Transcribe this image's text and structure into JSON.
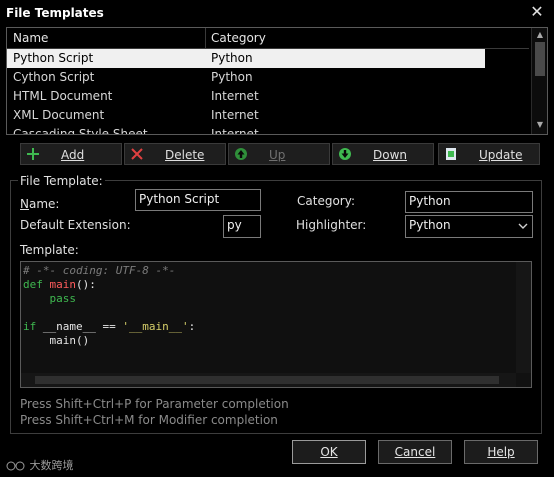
{
  "window": {
    "title": "File Templates",
    "close_glyph": "✕"
  },
  "table": {
    "columns": [
      "Name",
      "Category"
    ],
    "rows": [
      {
        "name": "Python Script",
        "category": "Python",
        "selected": true
      },
      {
        "name": "Cython Script",
        "category": "Python"
      },
      {
        "name": "HTML Document",
        "category": "Internet"
      },
      {
        "name": "XML Document",
        "category": "Internet"
      },
      {
        "name": "Cascading Style Sheet",
        "category": "Internet"
      }
    ]
  },
  "toolbar": {
    "add": "Add",
    "delete": "Delete",
    "up": "Up",
    "down": "Down",
    "update": "Update"
  },
  "file_template": {
    "group_label": "File Template:",
    "name_label": "Name:",
    "name_value": "Python Script",
    "ext_label": "Default Extension:",
    "ext_value": "py",
    "category_label": "Category:",
    "category_value": "Python",
    "highlighter_label": "Highlighter:",
    "highlighter_value": "Python",
    "template_label": "Template:"
  },
  "editor": {
    "lines": [
      "# -*- coding: UTF-8 -*-",
      "def main():",
      "    pass",
      "",
      "if __name__ == '__main__':",
      "    main()"
    ]
  },
  "hints": {
    "line1": "Press Shift+Ctrl+P for Parameter completion",
    "line2": "Press Shift+Ctrl+M for Modifier completion"
  },
  "buttons": {
    "ok": "OK",
    "cancel": "Cancel",
    "help": "Help"
  },
  "watermark": "大数跨境",
  "colors": {
    "accent_green": "#3fb950",
    "function_red": "#ff5c5c",
    "string_yellow": "#d6cf6a",
    "selection": "#f0f0f0"
  }
}
